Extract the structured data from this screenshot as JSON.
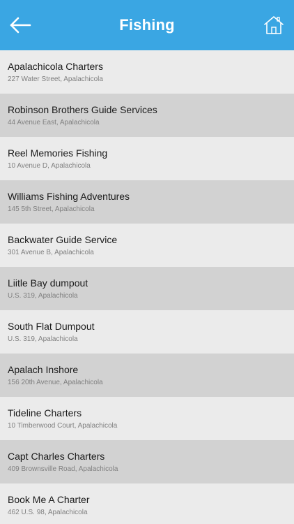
{
  "header": {
    "title": "Fishing",
    "back_icon": "arrow-left-icon",
    "home_icon": "home-icon",
    "color": "#3aa6e3"
  },
  "list": {
    "items": [
      {
        "name": "Apalachicola Charters",
        "address": "227 Water Street, Apalachicola"
      },
      {
        "name": "Robinson Brothers Guide Services",
        "address": "44 Avenue East, Apalachicola"
      },
      {
        "name": "Reel Memories Fishing",
        "address": "10 Avenue D, Apalachicola"
      },
      {
        "name": "Williams Fishing Adventures",
        "address": "145 5th Street, Apalachicola"
      },
      {
        "name": "Backwater Guide Service",
        "address": "301 Avenue B, Apalachicola"
      },
      {
        "name": "Liitle Bay dumpout",
        "address": "U.S. 319, Apalachicola"
      },
      {
        "name": "South Flat Dumpout",
        "address": "U.S. 319, Apalachicola"
      },
      {
        "name": "Apalach Inshore",
        "address": "156 20th Avenue, Apalachicola"
      },
      {
        "name": "Tideline Charters",
        "address": "10 Timberwood Court, Apalachicola"
      },
      {
        "name": "Capt Charles Charters",
        "address": "409 Brownsville Road, Apalachicola"
      },
      {
        "name": "Book Me A Charter",
        "address": "462 U.S. 98, Apalachicola"
      }
    ]
  }
}
